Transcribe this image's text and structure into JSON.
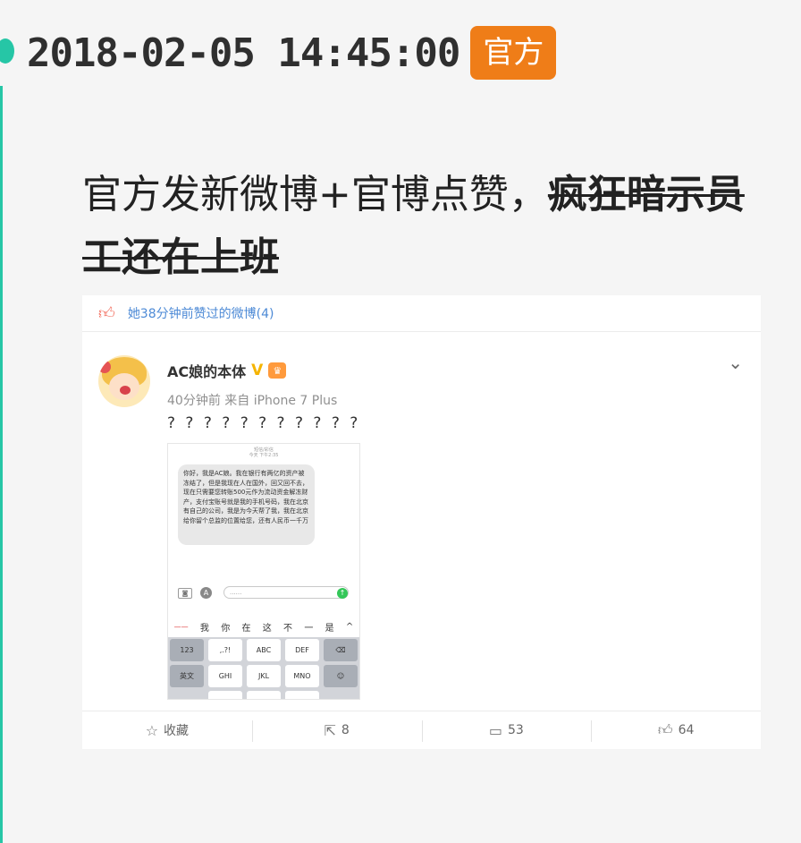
{
  "entry": {
    "timestamp": "2018-02-05 14:45:00",
    "badge": "官方",
    "headline_plain": "官方发新微博+官博点赞，",
    "headline_strike": "疯狂暗示员工还在上班"
  },
  "weibo": {
    "like_notice": "她38分钟前赞过的微博(4)",
    "username": "AC娘的本体",
    "verified_mark": "V",
    "meta": "40分钟前 来自 iPhone 7 Plus",
    "post_text": "? ? ? ? ? ? ? ? ? ? ?",
    "screenshot": {
      "time_header": "短信/彩信\n今天 下午2:35",
      "message": "你好，我是AC娘。我在银行有两亿的资产被冻结了，但是我现在人在国外，回又回不去，现在只需要您转账500元作为流动资金解冻财产，支付宝账号就是我的手机号码，我在北京有自己的公司，我是为今天帮了我，我在北京给你留个总监的位置给您，还有人民币一千万",
      "input_placeholder": "......",
      "suggestions": [
        "我",
        "你",
        "在",
        "这",
        "不",
        "一",
        "是"
      ],
      "keys_row1": [
        "123",
        ",.?!",
        "ABC",
        "DEF",
        "⌫"
      ],
      "keys_row2": [
        "英文",
        "GHI",
        "JKL",
        "MNO",
        "☺"
      ]
    },
    "actions": {
      "favorite_label": "收藏",
      "repost_count": "8",
      "comment_count": "53",
      "like_count": "64"
    }
  },
  "colors": {
    "timeline": "#26c6a6",
    "badge": "#ef7d18",
    "link": "#4d8ad6"
  }
}
